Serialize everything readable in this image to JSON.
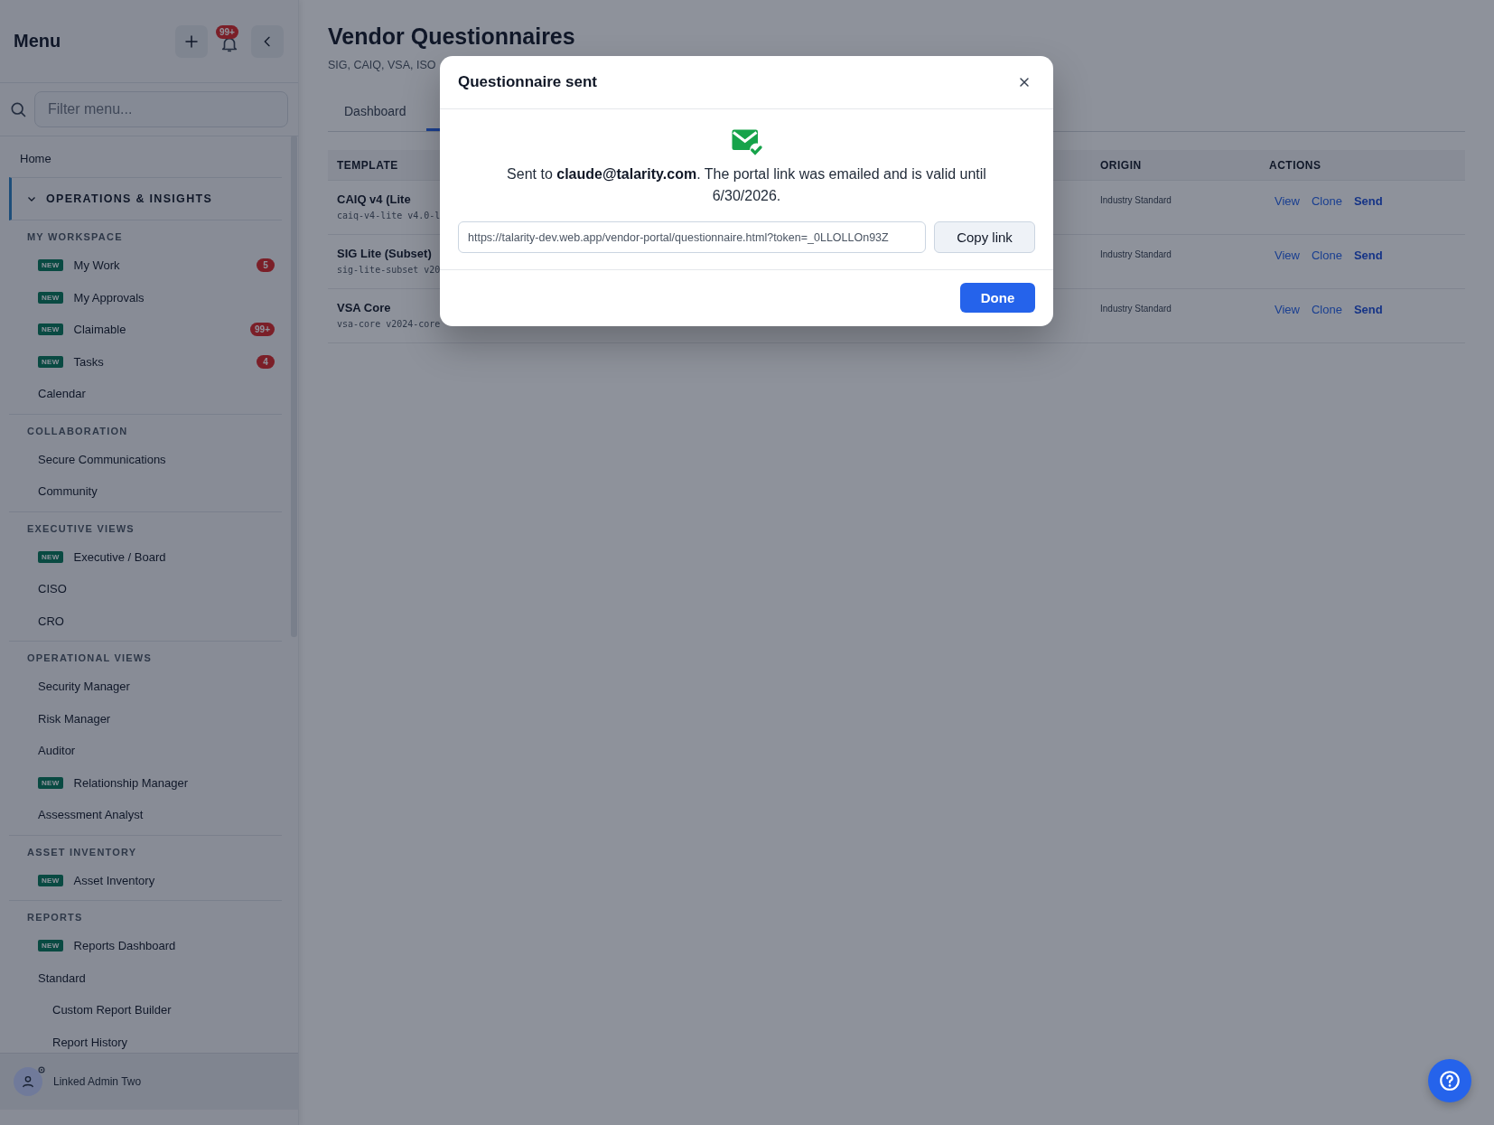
{
  "sidebar": {
    "title": "Menu",
    "notification_count": "99+",
    "search": {
      "placeholder": "Filter menu..."
    },
    "items": [
      {
        "label": "Home"
      }
    ],
    "group": {
      "label": "OPERATIONS & INSIGHTS",
      "expanded": true,
      "sections": [
        {
          "label": "MY WORKSPACE",
          "items": [
            {
              "label": "My Work",
              "badge": "NEW",
              "count": "5"
            },
            {
              "label": "My Approvals",
              "badge": "NEW"
            },
            {
              "label": "Claimable",
              "badge": "NEW",
              "count": "99+"
            },
            {
              "label": "Tasks",
              "badge": "NEW",
              "count": "4"
            },
            {
              "label": "Calendar"
            }
          ]
        },
        {
          "label": "COLLABORATION",
          "items": [
            {
              "label": "Secure Communications"
            },
            {
              "label": "Community"
            }
          ]
        },
        {
          "label": "EXECUTIVE VIEWS",
          "items": [
            {
              "label": "Executive / Board",
              "badge": "NEW"
            },
            {
              "label": "CISO"
            },
            {
              "label": "CRO"
            }
          ]
        },
        {
          "label": "OPERATIONAL VIEWS",
          "items": [
            {
              "label": "Security Manager"
            },
            {
              "label": "Risk Manager"
            },
            {
              "label": "Auditor"
            },
            {
              "label": "Relationship Manager",
              "badge": "NEW"
            },
            {
              "label": "Assessment Analyst"
            }
          ]
        },
        {
          "label": "ASSET INVENTORY",
          "items": [
            {
              "label": "Asset Inventory",
              "badge": "NEW"
            }
          ]
        },
        {
          "label": "REPORTS",
          "items": [
            {
              "label": "Reports Dashboard",
              "badge": "NEW"
            },
            {
              "label": "Standard",
              "children": [
                {
                  "label": "Custom Report Builder"
                },
                {
                  "label": "Report History"
                }
              ]
            }
          ]
        }
      ]
    },
    "user": {
      "name": "Linked Admin Two"
    }
  },
  "page": {
    "title": "Vendor Questionnaires",
    "subtitle": "SIG, CAIQ, VSA, ISO"
  },
  "tabs": [
    {
      "label": "Dashboard",
      "selected": false
    },
    {
      "selected": true
    }
  ],
  "table": {
    "columns": [
      "TEMPLATE",
      "ORIGIN",
      "ACTIONS"
    ],
    "rows": [
      {
        "name": "CAIQ v4 (Lite",
        "code": "caiq-v4-lite v4.0-l",
        "origin": "Industry Standard",
        "actions": [
          "View",
          "Clone",
          "Send"
        ]
      },
      {
        "name": "SIG Lite (Subset)",
        "code": "sig-lite-subset v20",
        "origin": "Industry Standard",
        "actions": [
          "View",
          "Clone",
          "Send"
        ]
      },
      {
        "name": "VSA Core",
        "code": "vsa-core v2024-core",
        "origin": "Industry Standard",
        "actions": [
          "View",
          "Clone",
          "Send"
        ]
      }
    ]
  },
  "modal": {
    "title": "Questionnaire sent",
    "message": "Sent to **claude@talarity.com**. The portal link was emailed and is valid until 6/30/2026.",
    "link": "https://talarity-dev.web.app/vendor-portal/questionnaire.html?token=_0LLOLLOn93Z",
    "copy_button": "Copy link",
    "done_button": "Done"
  }
}
